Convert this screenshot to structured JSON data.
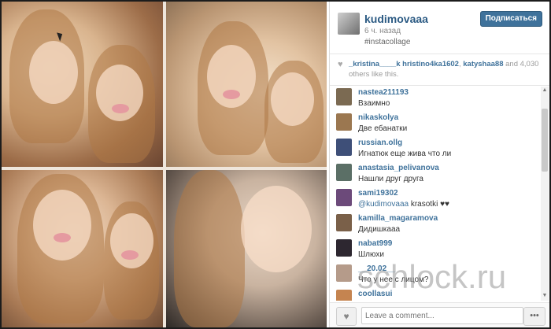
{
  "post": {
    "username": "kudimovaaa",
    "time_ago": "6 ч. назад",
    "caption": "#instacollage",
    "follow_label": "Подписаться"
  },
  "likes": {
    "users": [
      "_kristina____k",
      "hristino4ka1602",
      "katyshaa88"
    ],
    "count_text": "and 4,030 others like this."
  },
  "comments": [
    {
      "user": "nastea211193",
      "text": "Взаимно",
      "avatar_color": "#7b6a52"
    },
    {
      "user": "nikaskolya",
      "text": "Две ебанатки",
      "avatar_color": "#9b7750"
    },
    {
      "user": "russian.ollg",
      "text": "Игнатюк еще жива что ли",
      "avatar_color": "#3e4f78"
    },
    {
      "user": "anastasia_pelivanova",
      "text": "Нашли друг друга",
      "avatar_color": "#5b6f66"
    },
    {
      "user": "sami19302",
      "mention": "@kudimovaaa",
      "text": " krasotki ♥♥",
      "avatar_color": "#6c4a7a"
    },
    {
      "user": "kamilla_magaramova",
      "text": "Дидишкааа",
      "avatar_color": "#7a6049"
    },
    {
      "user": "nabat999",
      "text": "Шлюхи",
      "avatar_color": "#2d2730"
    },
    {
      "user": "__20.02__",
      "text": "Что у нее с лицом?",
      "avatar_color": "#b59b8a"
    },
    {
      "user": "coollasui",
      "text": "",
      "avatar_color": "#c58450"
    }
  ],
  "footer": {
    "comment_placeholder": "Leave a comment...",
    "more_label": "•••"
  },
  "watermark": "schlock.ru",
  "colors": {
    "link": "#3f729b",
    "follow_button": "#3f729b"
  }
}
